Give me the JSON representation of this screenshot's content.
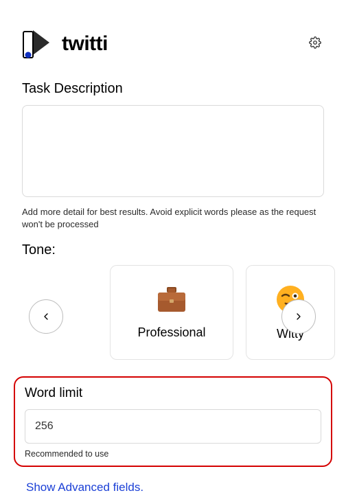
{
  "brand": "twitti",
  "task": {
    "label": "Task Description",
    "value": "",
    "hint": "Add more detail for best results. Avoid explicit words please as the request won't be processed"
  },
  "tone": {
    "label": "Tone:",
    "options": [
      {
        "label": "Professional",
        "icon": "briefcase-icon"
      },
      {
        "label": "Witty",
        "icon": "wink-emoji-icon"
      }
    ]
  },
  "word_limit": {
    "label": "Word limit",
    "value": "256",
    "hint": "Recommended to use"
  },
  "advanced_link": "Show Advanced fields."
}
